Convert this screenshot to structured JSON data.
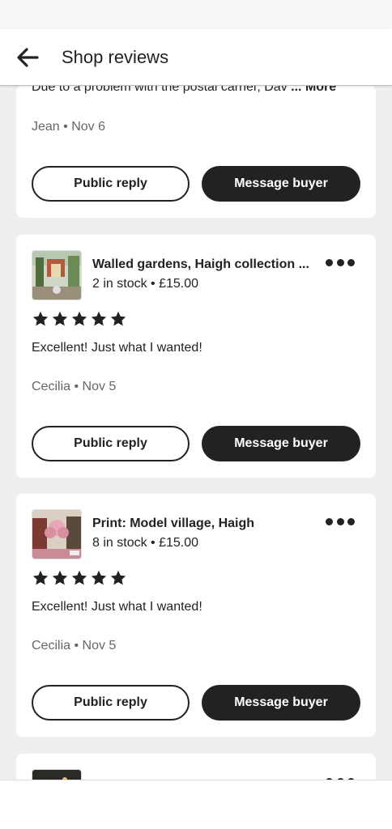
{
  "header": {
    "title": "Shop reviews",
    "back_icon": "arrow-left-icon"
  },
  "colors": {
    "dark_button": "#222222",
    "muted_text": "#666666",
    "background": "#efefef"
  },
  "reviews": [
    {
      "truncated_text": "Due to a problem with the postal carrier, Dav",
      "more_label": "... More",
      "author_date": "Jean • Nov 6",
      "reply_label": "Public reply",
      "message_label": "Message buyer"
    },
    {
      "item_title": "Walled gardens, Haigh collection ...",
      "item_sub": "2 in stock • £15.00",
      "rating": 5,
      "text": "Excellent! Just what I wanted!",
      "author_date": "Cecilia • Nov 5",
      "reply_label": "Public reply",
      "message_label": "Message buyer"
    },
    {
      "item_title": "Print: Model village, Haigh",
      "item_sub": "8 in stock • £15.00",
      "rating": 5,
      "text": "Excellent! Just what I wanted!",
      "author_date": "Cecilia • Nov 5",
      "reply_label": "Public reply",
      "message_label": "Message buyer"
    }
  ]
}
